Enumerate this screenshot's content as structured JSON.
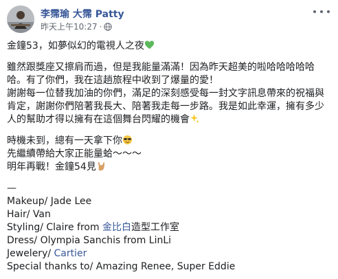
{
  "post": {
    "author": "李霈瑜 大霈 Patty",
    "timestamp": "昨天上午10:27",
    "separator": "·",
    "privacy_icon": "globe-icon",
    "menu_icon": "more-options-icon"
  },
  "body": {
    "line_title": "金鐘53，如夢似幻的電視人之夜",
    "para1": "雖然跟獎座又擦肩而過，但是我能量滿滿！因為昨天超美的啦哈哈哈哈哈哈。有了你們，我在這趟旅程中收到了爆量的愛！",
    "para2": "謝謝每一位替我加油的你們，滿足的深刻感受每一封文字訊息帶來的祝福與肯定，謝謝你們陪著我長大、陪著我走每一步路。我是如此幸運，擁有多少人的幫助才得以擁有在這個舞台閃耀的機會",
    "line_time": "時機未到，總有一天拿下你",
    "line_continue": "先繼續帶給大家正能量蛤～～～",
    "line_nextyear": "明年再戰！金鐘54見",
    "divider": "—",
    "makeup": "Makeup/ Jade Lee",
    "hair": "Hair/ Van",
    "styling_prefix": "Styling/ Claire from ",
    "styling_link": "金比白",
    "styling_suffix": "造型工作室",
    "dress": "Dress/ Olympia Sanchis from LinLi",
    "jewelry_prefix": "Jewelery/ ",
    "jewelry_link": "Cartier",
    "thanks": "Special thanks to/ Amazing Renee, Super Eddie"
  },
  "emoji": {
    "green_heart": "green-heart-emoji",
    "sparkles": "sparkles-emoji",
    "sunglasses": "sunglasses-emoji",
    "rock_hand": "rock-on-hand-emoji"
  },
  "colors": {
    "author_link": "#385898",
    "meta_text": "#616770",
    "body_text": "#1c1e21"
  }
}
